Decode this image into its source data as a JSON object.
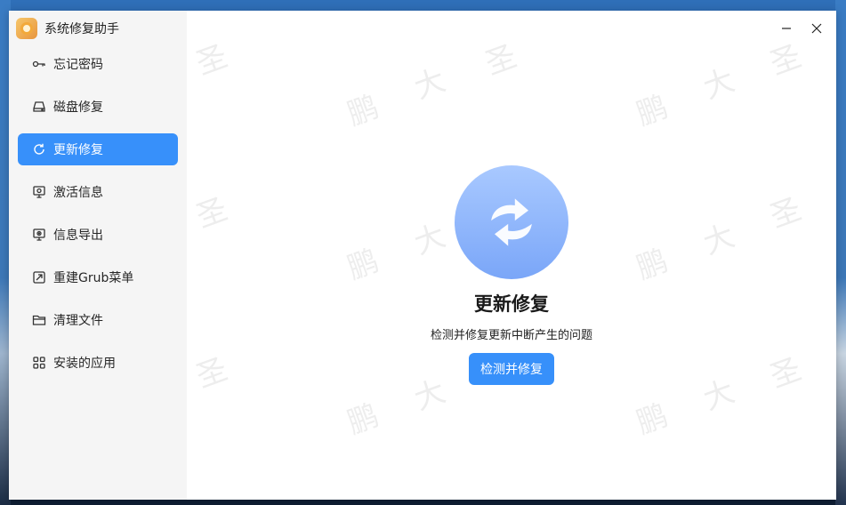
{
  "app": {
    "title": "系统修复助手"
  },
  "sidebar": {
    "items": [
      {
        "label": "忘记密码",
        "icon": "key-icon"
      },
      {
        "label": "磁盘修复",
        "icon": "disk-icon"
      },
      {
        "label": "更新修复",
        "icon": "refresh-icon",
        "active": true
      },
      {
        "label": "激活信息",
        "icon": "activation-icon"
      },
      {
        "label": "信息导出",
        "icon": "export-icon"
      },
      {
        "label": "重建Grub菜单",
        "icon": "grub-icon"
      },
      {
        "label": "清理文件",
        "icon": "folder-icon"
      },
      {
        "label": "安装的应用",
        "icon": "apps-icon"
      }
    ]
  },
  "main": {
    "title": "更新修复",
    "description": "检测并修复更新中断产生的问题",
    "button_label": "检测并修复"
  },
  "watermark": {
    "chars": [
      "圣",
      "大",
      "鹏"
    ]
  },
  "colors": {
    "accent": "#3790fa",
    "sidebar_bg": "#f5f5f5"
  }
}
